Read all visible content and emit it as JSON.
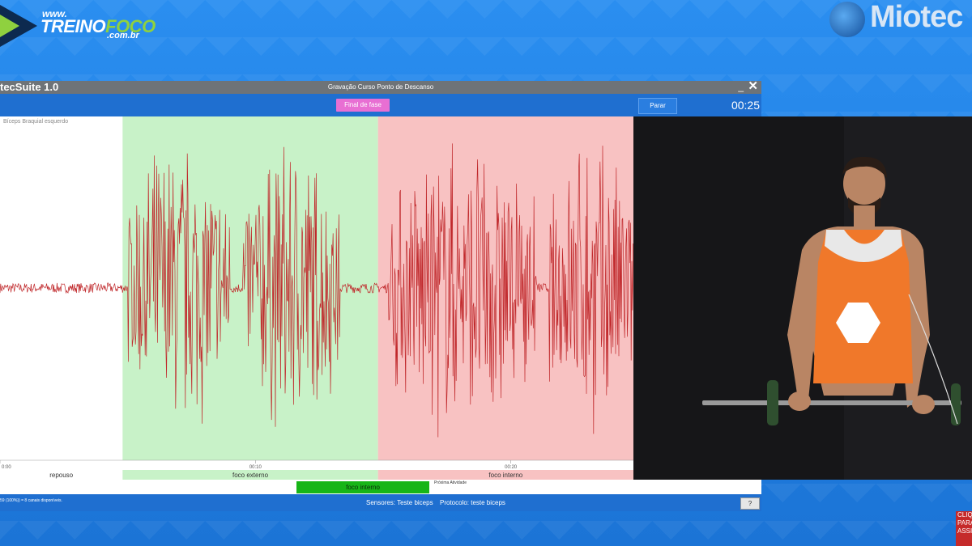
{
  "branding": {
    "site_www": "www.",
    "site_name_a": "TREINO",
    "site_name_b": "FOCO",
    "site_domain": ".com.br",
    "partner": "Miotec"
  },
  "window": {
    "app_title": "tecSuite 1.0",
    "recording_title": "Gravação Curso Ponto de Descanso",
    "min_glyph": "_",
    "close_glyph": "✕"
  },
  "toolbar": {
    "phase_button": "Final de fase",
    "stop_button": "Parar",
    "timer": "00:25"
  },
  "chart": {
    "channel_label": "Bíceps Braquial esquerdo",
    "time_ticks": [
      "0:00",
      "00:10",
      "00:20"
    ],
    "phases": [
      "repouso",
      "foco externo",
      "foco interno"
    ]
  },
  "chart_data": {
    "type": "line",
    "title": "",
    "series": [
      {
        "name": "Bíceps Braquial esquerdo",
        "signal": "EMG raw"
      }
    ],
    "x_unit": "s",
    "x_ticks": [
      "0:00",
      "00:10",
      "00:20"
    ],
    "phases": [
      {
        "label": "repouso",
        "start_s": 0.0,
        "end_s": 4.8,
        "color": "#ffffff",
        "relative_amplitude": 0.03
      },
      {
        "label": "foco externo",
        "start_s": 4.8,
        "end_s": 14.8,
        "color": "#c8f2c8",
        "relative_amplitude": 0.8
      },
      {
        "label": "foco interno",
        "start_s": 14.8,
        "end_s": 24.8,
        "color": "#f8c2c2",
        "relative_amplitude": 1.0
      }
    ],
    "bursts": [
      {
        "start_s": 5.0,
        "end_s": 9.0,
        "peak": 1.0
      },
      {
        "start_s": 9.5,
        "end_s": 13.3,
        "peak": 1.0
      },
      {
        "start_s": 15.2,
        "end_s": 21.0,
        "peak": 1.0
      },
      {
        "start_s": 21.5,
        "end_s": 24.8,
        "peak": 1.0
      }
    ],
    "trace_color": "#c0282b",
    "grid": false
  },
  "phase_bar": {
    "current": "foco interno",
    "next_label": "Próxima Atividade"
  },
  "status": {
    "channels": "59 (100%)) = 8 canais disponíveis.",
    "sensors": "Sensores: Teste biceps",
    "protocol": "Protocolo: teste biceps",
    "help": "?"
  },
  "overlay": {
    "click_badge": "CLIQ PARA ASSI"
  }
}
